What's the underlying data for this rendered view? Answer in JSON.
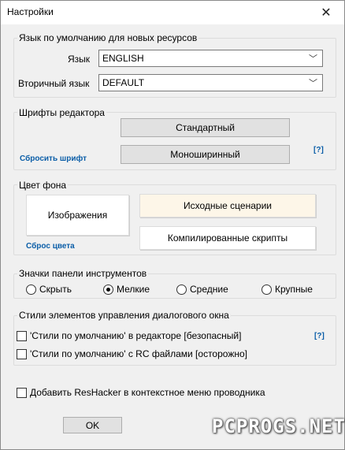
{
  "window": {
    "title": "Настройки"
  },
  "language": {
    "group_label": "Язык по умолчанию для новых ресурсов",
    "language_label": "Язык",
    "language_value": "ENGLISH",
    "secondary_label": "Вторичный язык",
    "secondary_value": "DEFAULT"
  },
  "fonts": {
    "group_label": "Шрифты редактора",
    "standard_button": "Стандартный",
    "mono_button": "Моноширинный",
    "reset_link": "Сбросить шрифт",
    "help_link": "[?]"
  },
  "background": {
    "group_label": "Цвет фона",
    "images_button": "Изображения",
    "source_scripts_button": "Исходные сценарии",
    "compiled_scripts_button": "Компилированные скрипты",
    "reset_link": "Сброс цвета"
  },
  "toolbar_icons": {
    "group_label": "Значки панели инструментов",
    "options": [
      "Скрыть",
      "Мелкие",
      "Средние",
      "Крупные"
    ],
    "selected": "Мелкие"
  },
  "dialog_styles": {
    "group_label": "Стили элементов управления диалогового окна",
    "option1": "'Стили по умолчанию' в редакторе [безопасный]",
    "option2": "'Стили по умолчанию' с RC файлами [осторожно]",
    "help_link": "[?]"
  },
  "context_menu": {
    "label": "Добавить ResHacker в контекстное меню проводника"
  },
  "buttons": {
    "ok": "OK"
  },
  "watermark": {
    "text": "PCPROGS.NET"
  }
}
